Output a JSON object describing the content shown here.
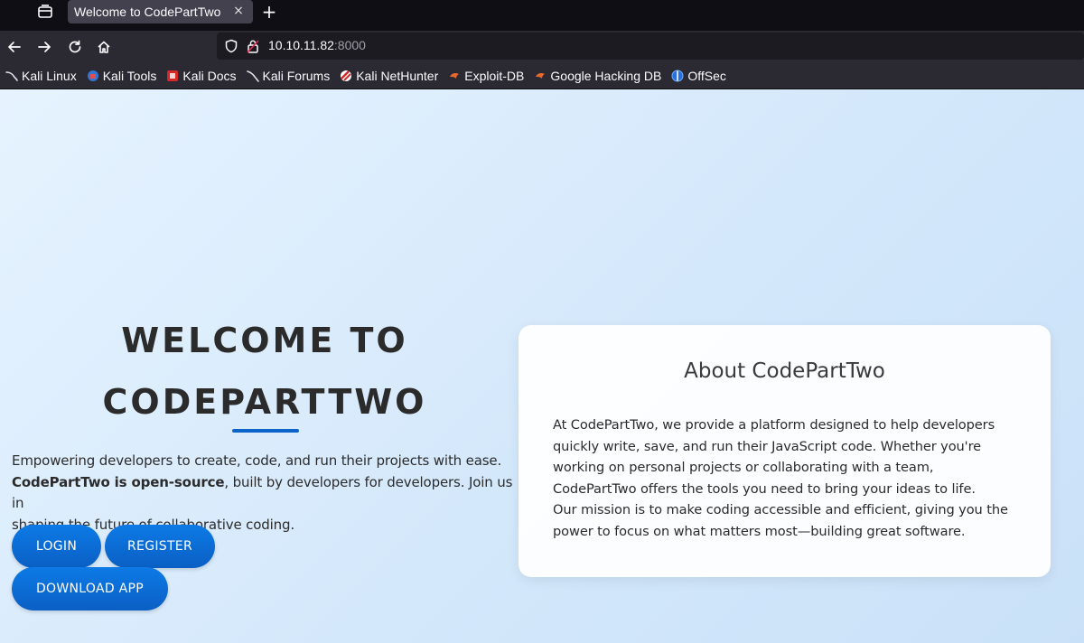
{
  "browser": {
    "tab": {
      "title": "Welcome to CodePartTwo",
      "close_glyph": "×"
    },
    "newtab_glyph": "+",
    "url": {
      "host": "10.10.11.82",
      "port": ":8000"
    },
    "bookmarks": [
      {
        "label": "Kali Linux",
        "icon": "kali-dragon-icon"
      },
      {
        "label": "Kali Tools",
        "icon": "kali-tools-icon"
      },
      {
        "label": "Kali Docs",
        "icon": "kali-docs-icon"
      },
      {
        "label": "Kali Forums",
        "icon": "kali-forums-icon"
      },
      {
        "label": "Kali NetHunter",
        "icon": "nethunter-icon"
      },
      {
        "label": "Exploit-DB",
        "icon": "exploit-db-icon"
      },
      {
        "label": "Google Hacking DB",
        "icon": "ghdb-icon"
      },
      {
        "label": "OffSec",
        "icon": "offsec-icon"
      }
    ]
  },
  "hero": {
    "title_line1": "WELCOME TO",
    "title_line2": "CODEPARTTWO",
    "text_line1": "Empowering developers to create, code, and run their projects with ease.",
    "text_strong": "CodePartTwo is open-source",
    "text_line2_rest": ", built by developers for developers. Join us in",
    "text_line3": "shaping the future of collaborative coding.",
    "buttons": {
      "login": "LOGIN",
      "register": "REGISTER",
      "download": "DOWNLOAD APP"
    }
  },
  "about": {
    "title": "About CodePartTwo",
    "lines": [
      "At CodePartTwo, we provide a platform designed to help developers",
      "quickly write, save, and run their JavaScript code. Whether you're",
      "working on personal projects or collaborating with a team,",
      "CodePartTwo offers the tools you need to bring your ideas to life.",
      "Our mission is to make coding accessible and efficient, giving you the",
      "power to focus on what matters most—building great software."
    ]
  },
  "colors": {
    "accent": "#0a6fd6",
    "page_bg_start": "#e6f3ff",
    "page_bg_end": "#c9e1f8",
    "heading_text": "#2b2b2b"
  }
}
